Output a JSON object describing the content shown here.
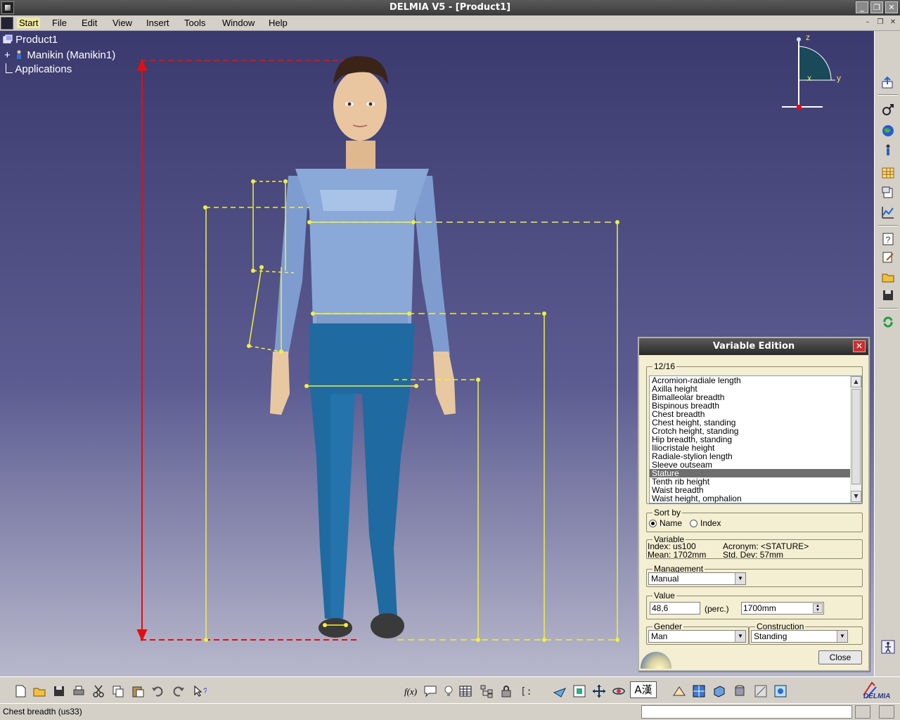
{
  "window": {
    "title": "DELMIA V5 - [Product1]"
  },
  "menu": {
    "items": [
      "Start",
      "File",
      "Edit",
      "View",
      "Insert",
      "Tools",
      "Window",
      "Help"
    ]
  },
  "tree": {
    "root": "Product1",
    "child": "Manikin (Manikin1)",
    "applications": "Applications"
  },
  "compass": {
    "z": "z",
    "x": "x",
    "y": "y"
  },
  "colors": {
    "viewport_top": "#3a3a6e",
    "viewport_bottom": "#b8b8cc",
    "measure_lines": "#f0f040",
    "stature_line": "#e01010",
    "shirt": "#8aa8d8",
    "pants": "#1f6aa0",
    "dialog_bg": "#f4eed2",
    "selected_item": "#6e6e6e"
  },
  "dialog": {
    "title": "Variable Edition",
    "list_group": "12/16",
    "list_items": [
      "Acromion-radiale length",
      "Axilla height",
      "Bimalleolar breadth",
      "Bispinous breadth",
      "Chest breadth",
      "Chest height, standing",
      "Crotch height, standing",
      "Hip breadth, standing",
      "Iliocristale height",
      "Radiale-stylion length",
      "Sleeve outseam",
      "Stature",
      "Tenth rib height",
      "Waist breadth",
      "Waist height, omphalion"
    ],
    "selected_item": "Stature",
    "sort_by": {
      "label": "Sort by",
      "name": "Name",
      "index": "Index",
      "selected": "Name"
    },
    "variable": {
      "label": "Variable",
      "index": "Index: us100",
      "acronym": "Acronym: <STATURE>",
      "mean": "Mean: 1702mm",
      "std_dev": "Std. Dev: 57mm"
    },
    "management": {
      "label": "Management",
      "value": "Manual"
    },
    "value": {
      "label": "Value",
      "percent": "48,6",
      "perc_label": "(perc.)",
      "mm": "1700mm"
    },
    "gender": {
      "label": "Gender",
      "value": "Man"
    },
    "construction": {
      "label": "Construction",
      "value": "Standing"
    },
    "close": "Close"
  },
  "toolbar": {
    "font_button": "A漢"
  },
  "status": {
    "text": "Chest breadth (us33)",
    "command_input": ""
  },
  "brand": "DELMIA"
}
